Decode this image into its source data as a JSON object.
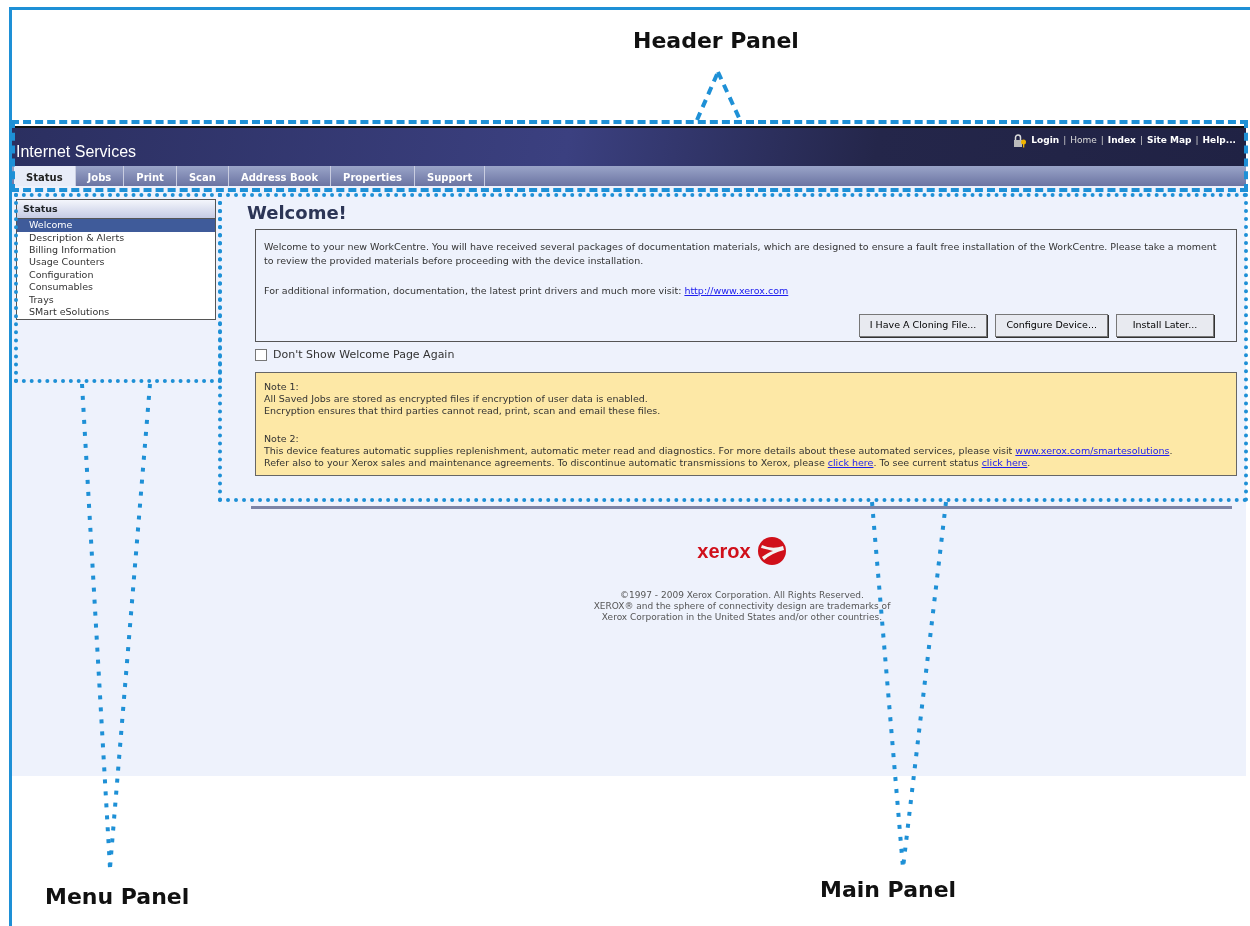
{
  "annotations": [
    {
      "label": "Header Panel"
    },
    {
      "label": "Menu Panel"
    },
    {
      "label": "Main Panel"
    }
  ],
  "header": {
    "title": "Internet Services",
    "separator": "|",
    "links": [
      {
        "label": "Login",
        "bold": true
      },
      {
        "label": "Home",
        "bold": false
      },
      {
        "label": "Index",
        "bold": true
      },
      {
        "label": "Site Map",
        "bold": true
      },
      {
        "label": "Help...",
        "bold": true
      }
    ]
  },
  "tabs": [
    {
      "label": "Status",
      "selected": true
    },
    {
      "label": "Jobs",
      "selected": false
    },
    {
      "label": "Print",
      "selected": false
    },
    {
      "label": "Scan",
      "selected": false
    },
    {
      "label": "Address Book",
      "selected": false
    },
    {
      "label": "Properties",
      "selected": false
    },
    {
      "label": "Support",
      "selected": false
    }
  ],
  "menu": {
    "title": "Status",
    "items": [
      {
        "label": "Welcome",
        "selected": true
      },
      {
        "label": "Description & Alerts",
        "selected": false
      },
      {
        "label": "Billing Information",
        "selected": false
      },
      {
        "label": "Usage Counters",
        "selected": false
      },
      {
        "label": "Configuration",
        "selected": false
      },
      {
        "label": "Consumables",
        "selected": false
      },
      {
        "label": "Trays",
        "selected": false
      },
      {
        "label": "SMart eSolutions",
        "selected": false
      }
    ]
  },
  "main": {
    "heading": "Welcome!",
    "intro": "Welcome to your new WorkCentre. You will have received several packages of documentation materials, which are designed to ensure a fault free installation of the WorkCentre. Please take a moment to review the provided materials before proceeding with the device installation.",
    "info": [
      {
        "text": "For additional information, documentation, the latest print drivers and much more visit: "
      },
      {
        "link": "http://www.xerox.com"
      }
    ],
    "buttons": [
      "I Have A Cloning File...",
      "Configure Device...",
      "Install Later..."
    ],
    "checkbox": {
      "label": "Don't Show Welcome Page Again",
      "checked": false
    },
    "notes": [
      {
        "title": "Note 1:",
        "lines": [
          [
            {
              "text": "All Saved Jobs are stored as encrypted files if encryption of user data is enabled."
            }
          ],
          [
            {
              "text": "Encryption ensures that third parties cannot read, print, scan and email these files."
            }
          ]
        ]
      },
      {
        "title": "Note 2:",
        "lines": [
          [
            {
              "text": "This device features automatic supplies replenishment, automatic meter read and diagnostics. For more details about these automated services, please visit "
            },
            {
              "link": "www.xerox.com/smartesolutions"
            },
            {
              "text": "."
            }
          ],
          [
            {
              "text": "Refer also to your Xerox sales and maintenance agreements. To discontinue automatic transmissions to Xerox, please "
            },
            {
              "link": "click here"
            },
            {
              "text": ". To see current status "
            },
            {
              "link": "click here"
            },
            {
              "text": "."
            }
          ]
        ]
      }
    ]
  },
  "footer": {
    "logo": "xerox",
    "copyright": [
      "©1997 - 2009 Xerox Corporation. All Rights Reserved.",
      "XEROX® and the sphere of connectivity design are trademarks of",
      "Xerox Corporation in the United States and/or other countries."
    ]
  }
}
